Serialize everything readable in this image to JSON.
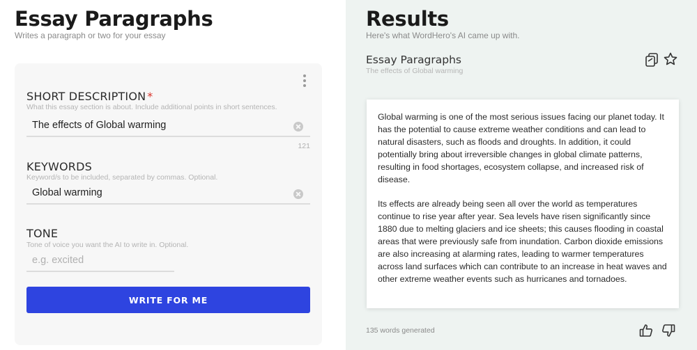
{
  "form": {
    "title": "Essay Paragraphs",
    "subtitle": "Writes a paragraph or two for your essay",
    "short_description": {
      "label": "SHORT DESCRIPTION",
      "required_mark": "*",
      "hint": "What this essay section is about. Include additional points in short sentences.",
      "value": "The effects of Global warming",
      "counter": "121"
    },
    "keywords": {
      "label": "KEYWORDS",
      "hint": "Keyword/s to be included, separated by commas. Optional.",
      "value": "Global warming"
    },
    "tone": {
      "label": "TONE",
      "hint": "Tone of voice you want the AI to write in. Optional.",
      "placeholder": "e.g. excited"
    },
    "submit_label": "WRITE FOR ME"
  },
  "results": {
    "title": "Results",
    "subtitle": "Here's what WordHero's AI came up with.",
    "item": {
      "heading": "Essay Paragraphs",
      "subheading": "The effects of Global warming",
      "paragraphs": [
        "Global warming is one of the most serious issues facing our planet today. It has the potential to cause extreme weather conditions and can lead to natural disasters, such as floods and droughts. In addition, it could potentially bring about irreversible changes in global climate patterns, resulting in food shortages, ecosystem collapse, and increased risk of disease.",
        "Its effects are already being seen all over the world as temperatures continue to rise year after year. Sea levels have risen significantly since 1880 due to melting glaciers and ice sheets; this causes flooding in coastal areas that were previously safe from inundation. Carbon dioxide emissions are also increasing at alarming rates, leading to warmer temperatures across land surfaces which can contribute to an increase in heat waves and other extreme weather events such as hurricanes and tornadoes."
      ],
      "word_count": "135 words generated"
    },
    "icons": {
      "copy": "copy-icon",
      "favorite": "star-icon",
      "like": "thumbs-up-icon",
      "dislike": "thumbs-down-icon"
    }
  },
  "colors": {
    "accent": "#2e44e0",
    "required": "#d9342b",
    "results_bg": "#eef3f1",
    "card_bg": "#f7f7f7"
  }
}
